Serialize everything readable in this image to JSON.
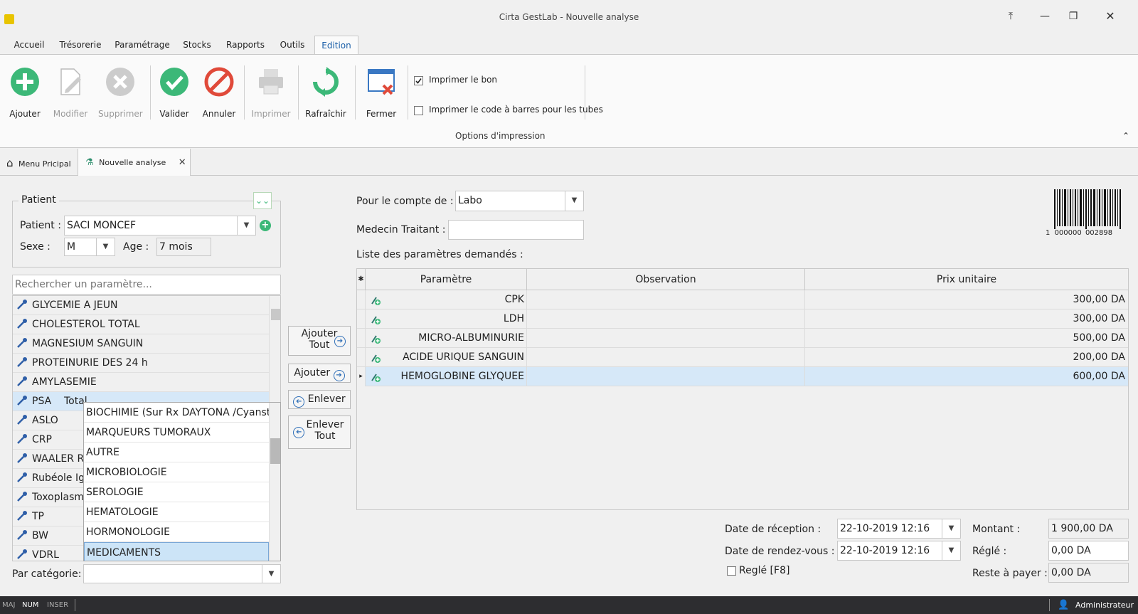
{
  "window": {
    "title": "Cirta GestLab - Nouvelle analyse"
  },
  "menu": [
    "Accueil",
    "Trésorerie",
    "Paramétrage",
    "Stocks",
    "Rapports",
    "Outils",
    "Edition"
  ],
  "ribbon": {
    "buttons": {
      "ajouter": "Ajouter",
      "modifier": "Modifier",
      "supprimer": "Supprimer",
      "valider": "Valider",
      "annuler": "Annuler",
      "imprimer": "Imprimer",
      "rafraichir": "Rafraîchir",
      "fermer": "Fermer"
    },
    "options": {
      "print_bon": "Imprimer le bon",
      "print_barcode": "Imprimer le code à barres pour les tubes",
      "group_label": "Options d'impression"
    }
  },
  "doc_tabs": {
    "menu": "Menu Pricipal",
    "current": "Nouvelle analyse"
  },
  "patient": {
    "group": "Patient",
    "name_label": "Patient :",
    "name": "SACI MONCEF",
    "sexe_label": "Sexe :",
    "sexe": "M",
    "age_label": "Age :",
    "age": "7 mois"
  },
  "search": {
    "placeholder": "Rechercher un paramètre..."
  },
  "param_list": [
    "GLYCEMIE A JEUN",
    "CHOLESTEROL TOTAL",
    "MAGNESIUM SANGUIN",
    "PROTEINURIE DES 24 h",
    "AMYLASEMIE",
    "PSA    Total",
    "ASLO",
    "CRP",
    "WAALER ROSE",
    "Rubéole  IgG",
    "Toxoplasmose",
    "TP",
    "BW",
    "VDRL"
  ],
  "category_popup": [
    "BIOCHIMIE (Sur Rx DAYTONA /Cyanstar)",
    "MARQUEURS TUMORAUX",
    "AUTRE",
    "MICROBIOLOGIE",
    "SEROLOGIE",
    "HEMATOLOGIE",
    "HORMONOLOGIE",
    "MEDICAMENTS"
  ],
  "category": {
    "label": "Par catégorie:",
    "value": ""
  },
  "mid_buttons": {
    "add_all_1": "Ajouter",
    "add_all_2": "Tout",
    "add": "Ajouter",
    "remove": "Enlever",
    "remove_all_1": "Enlever",
    "remove_all_2": "Tout"
  },
  "account": {
    "label": "Pour le compte de :",
    "value": "Labo"
  },
  "doctor": {
    "label": "Medecin Traitant :",
    "value": ""
  },
  "barcode": {
    "text_left": "1",
    "text_mid": "000000",
    "text_right": "002898"
  },
  "requested": {
    "title": "Liste des paramètres demandés :",
    "columns": [
      "Paramètre",
      "Observation",
      "Prix unitaire"
    ],
    "rows": [
      {
        "param": "CPK",
        "obs": "",
        "price": "300,00 DA"
      },
      {
        "param": "LDH",
        "obs": "",
        "price": "300,00 DA"
      },
      {
        "param": "MICRO-ALBUMINURIE",
        "obs": "",
        "price": "500,00 DA"
      },
      {
        "param": "ACIDE URIQUE SANGUIN",
        "obs": "",
        "price": "200,00 DA"
      },
      {
        "param": "HEMOGLOBINE GLYQUEE",
        "obs": "",
        "price": "600,00 DA"
      }
    ]
  },
  "dates": {
    "reception_label": "Date de réception :",
    "reception": "22-10-2019 12:16",
    "rdv_label": "Date de rendez-vous :",
    "rdv": "22-10-2019 12:16",
    "regle_chk": "Reglé [F8]"
  },
  "totals": {
    "montant_label": "Montant :",
    "montant": "1 900,00 DA",
    "regle_label": "Réglé :",
    "regle": "0,00 DA",
    "reste_label": "Reste à payer :",
    "reste": "0,00 DA"
  },
  "status": {
    "maj": "MAJ",
    "num": "NUM",
    "inser": "INSER",
    "user": "Administrateur"
  }
}
